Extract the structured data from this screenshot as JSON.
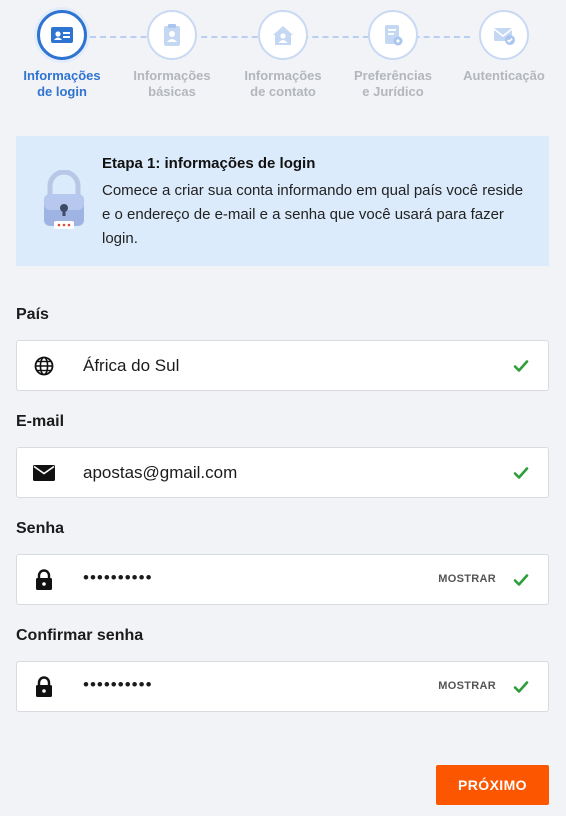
{
  "stepper": {
    "steps": [
      {
        "line1": "Informações",
        "line2": "de login",
        "icon": "id-card-icon",
        "active": true
      },
      {
        "line1": "Informações",
        "line2": "básicas",
        "icon": "clipboard-user-icon",
        "active": false
      },
      {
        "line1": "Informações",
        "line2": "de contato",
        "icon": "house-user-icon",
        "active": false
      },
      {
        "line1": "Preferências",
        "line2": "e Jurídico",
        "icon": "document-settings-icon",
        "active": false
      },
      {
        "line1": "Autenticação",
        "line2": "",
        "icon": "email-check-icon",
        "active": false
      }
    ]
  },
  "info": {
    "title": "Etapa 1: informações de login",
    "text": "Comece a criar sua conta informando em qual país você reside e o endereço de e-mail e a senha que você usará para fazer login.",
    "icon": "padlock-illustration"
  },
  "form": {
    "country": {
      "label": "País",
      "value": "África do Sul",
      "icon": "globe-icon"
    },
    "email": {
      "label": "E-mail",
      "value": "apostas@gmail.com",
      "icon": "envelope-icon"
    },
    "password": {
      "label": "Senha",
      "value": "••••••••••",
      "show_label": "MOSTRAR",
      "icon": "lock-icon"
    },
    "confirm": {
      "label": "Confirmar senha",
      "value": "••••••••••",
      "show_label": "MOSTRAR",
      "icon": "lock-icon"
    }
  },
  "next_button": {
    "label": "PRÓXIMO"
  },
  "colors": {
    "accent": "#2f74d0",
    "cta": "#fd5600",
    "valid": "#2e9e3a",
    "info_bg": "#dcebfb"
  }
}
